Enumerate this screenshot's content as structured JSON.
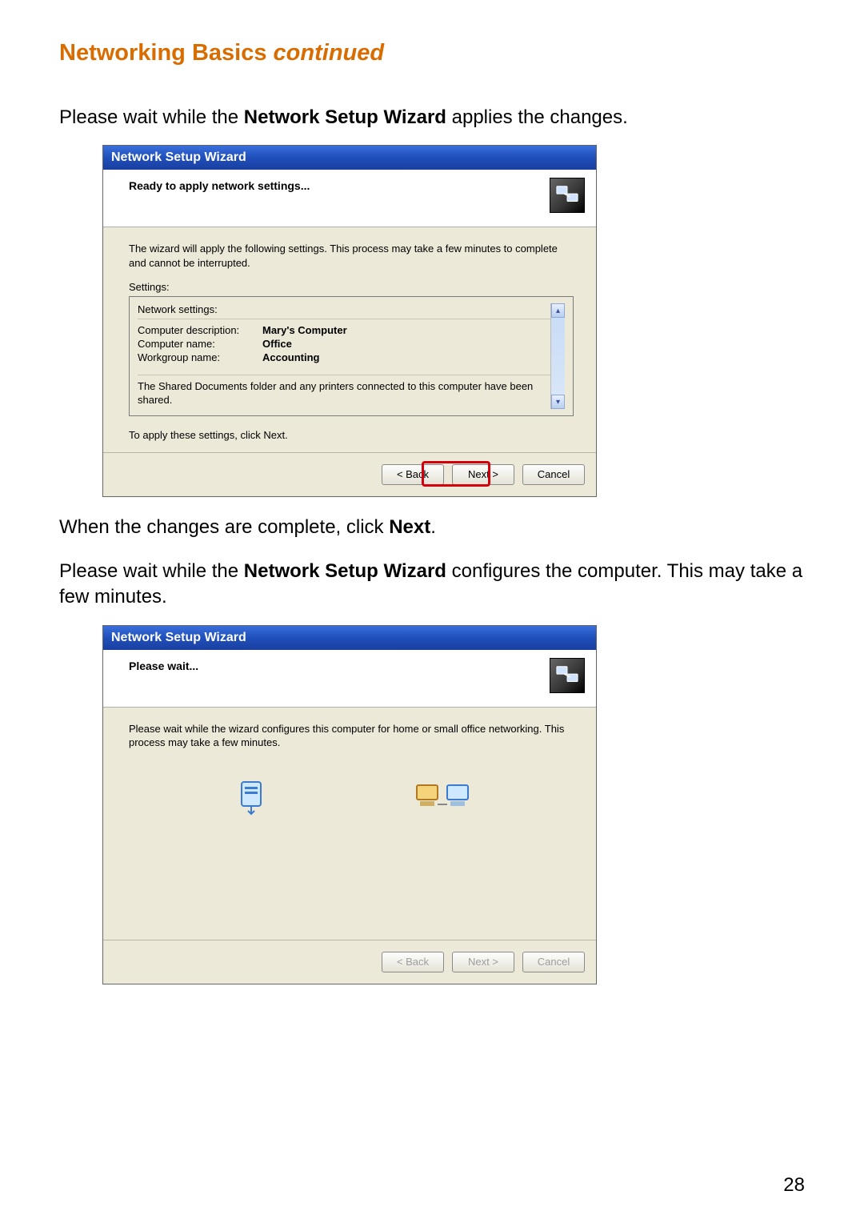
{
  "heading": {
    "title": "Networking Basics",
    "continued": "continued"
  },
  "para1": {
    "pre": "Please wait while the ",
    "bold": "Network Setup Wizard",
    "post": " applies the changes."
  },
  "wizard1": {
    "title": "Network Setup Wizard",
    "header": "Ready to apply network settings...",
    "body_text": "The wizard will apply the following settings. This process may take a few minutes to complete and cannot be interrupted.",
    "settings_label": "Settings:",
    "subhead": "Network settings:",
    "rows": {
      "desc_key": "Computer description:",
      "desc_val": "Mary's Computer",
      "name_key": "Computer name:",
      "name_val": "Office",
      "wg_key": "Workgroup name:",
      "wg_val": "Accounting"
    },
    "footnote": "The Shared Documents folder and any printers connected to this computer have been shared.",
    "apply_note": "To apply these settings, click Next.",
    "buttons": {
      "back": "< Back",
      "next": "Next >",
      "cancel": "Cancel"
    }
  },
  "para2": {
    "pre": "When the changes are complete, click ",
    "bold": "Next",
    "post": "."
  },
  "para3": {
    "pre": "Please wait while the ",
    "bold": "Network Setup Wizard",
    "post": " configures the computer. This may take a few minutes."
  },
  "wizard2": {
    "title": "Network Setup Wizard",
    "header": "Please wait...",
    "body_text": "Please wait while the wizard configures this computer for home or small office networking. This process may take a few minutes.",
    "buttons": {
      "back": "< Back",
      "next": "Next >",
      "cancel": "Cancel"
    }
  },
  "page_number": "28"
}
